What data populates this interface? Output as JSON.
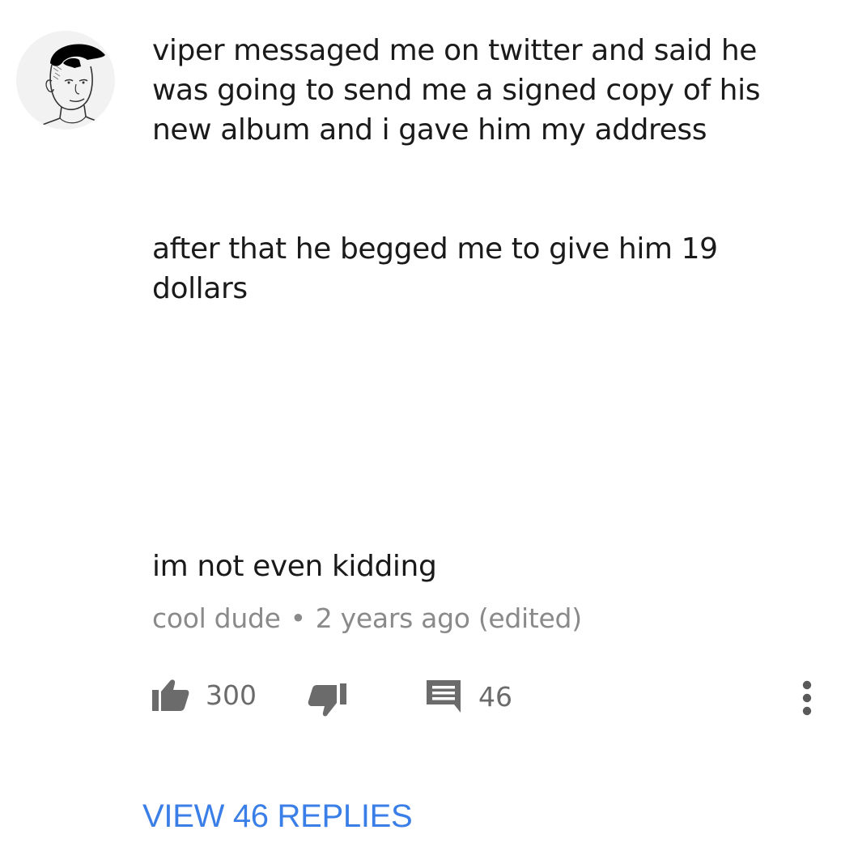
{
  "comment": {
    "author_avatar_icon": "wojak-avatar-icon",
    "paragraphs": [
      "viper messaged me on twitter and said he was going to send me a signed copy of his new album and i gave him my address",
      "after that he begged me to give him 19 dollars",
      "im not even kidding"
    ],
    "author": "cool dude",
    "separator": "•",
    "time": "2 years ago (edited)"
  },
  "actions": {
    "like_icon": "thumbs-up-icon",
    "like_count": "300",
    "dislike_icon": "thumbs-down-icon",
    "reply_icon": "comment-icon",
    "reply_count": "46",
    "more_icon": "more-vertical-icon"
  },
  "replies": {
    "label": "VIEW 46 REPLIES",
    "color": "#3a7ee8"
  },
  "colors": {
    "text": "#1a1a1a",
    "meta": "#8a8a8a",
    "icon": "#6b6b6b"
  }
}
